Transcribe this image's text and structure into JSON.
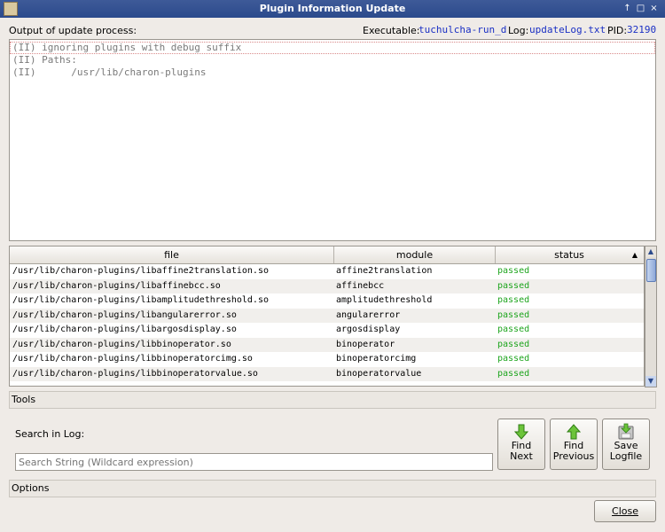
{
  "window": {
    "title": "Plugin Information Update",
    "controls": [
      "↑",
      "□",
      "×"
    ]
  },
  "header": {
    "output_label": "Output of update process:",
    "executable_label": "Executable:",
    "executable_value": "tuchulcha-run_d",
    "log_label": "Log:",
    "log_value": "updateLog.txt",
    "pid_label": "PID:",
    "pid_value": "32190"
  },
  "log": {
    "lines": [
      "(II) ignoring plugins with debug suffix",
      "(II) Paths:",
      "(II)      /usr/lib/charon-plugins"
    ]
  },
  "table": {
    "columns": [
      "file",
      "module",
      "status"
    ],
    "sort_indicator": "▲",
    "rows": [
      {
        "file": "/usr/lib/charon-plugins/libaffine2translation.so",
        "module": "affine2translation",
        "status": "passed"
      },
      {
        "file": "/usr/lib/charon-plugins/libaffinebcc.so",
        "module": "affinebcc",
        "status": "passed"
      },
      {
        "file": "/usr/lib/charon-plugins/libamplitudethreshold.so",
        "module": "amplitudethreshold",
        "status": "passed"
      },
      {
        "file": "/usr/lib/charon-plugins/libangularerror.so",
        "module": "angularerror",
        "status": "passed"
      },
      {
        "file": "/usr/lib/charon-plugins/libargosdisplay.so",
        "module": "argosdisplay",
        "status": "passed"
      },
      {
        "file": "/usr/lib/charon-plugins/libbinoperator.so",
        "module": "binoperator",
        "status": "passed"
      },
      {
        "file": "/usr/lib/charon-plugins/libbinoperatorcimg.so",
        "module": "binoperatorcimg",
        "status": "passed"
      },
      {
        "file": "/usr/lib/charon-plugins/libbinoperatorvalue.so",
        "module": "binoperatorvalue",
        "status": "passed"
      }
    ]
  },
  "tools": {
    "section_label": "Tools",
    "search_label": "Search in Log:",
    "search_placeholder": "Search String (Wildcard expression)",
    "find_next_line1": "Find",
    "find_next_line2": "Next",
    "find_prev_line1": "Find",
    "find_prev_line2": "Previous",
    "save_line1": "Save",
    "save_line2": "Logfile"
  },
  "options": {
    "section_label": "Options"
  },
  "footer": {
    "close_label": "Close"
  },
  "colors": {
    "titlebar": "#2b4a8c",
    "passed": "#1ea51e",
    "link": "#1a2fc4"
  },
  "icons": [
    "arrow-down-icon",
    "arrow-up-icon",
    "save-disk-icon"
  ]
}
